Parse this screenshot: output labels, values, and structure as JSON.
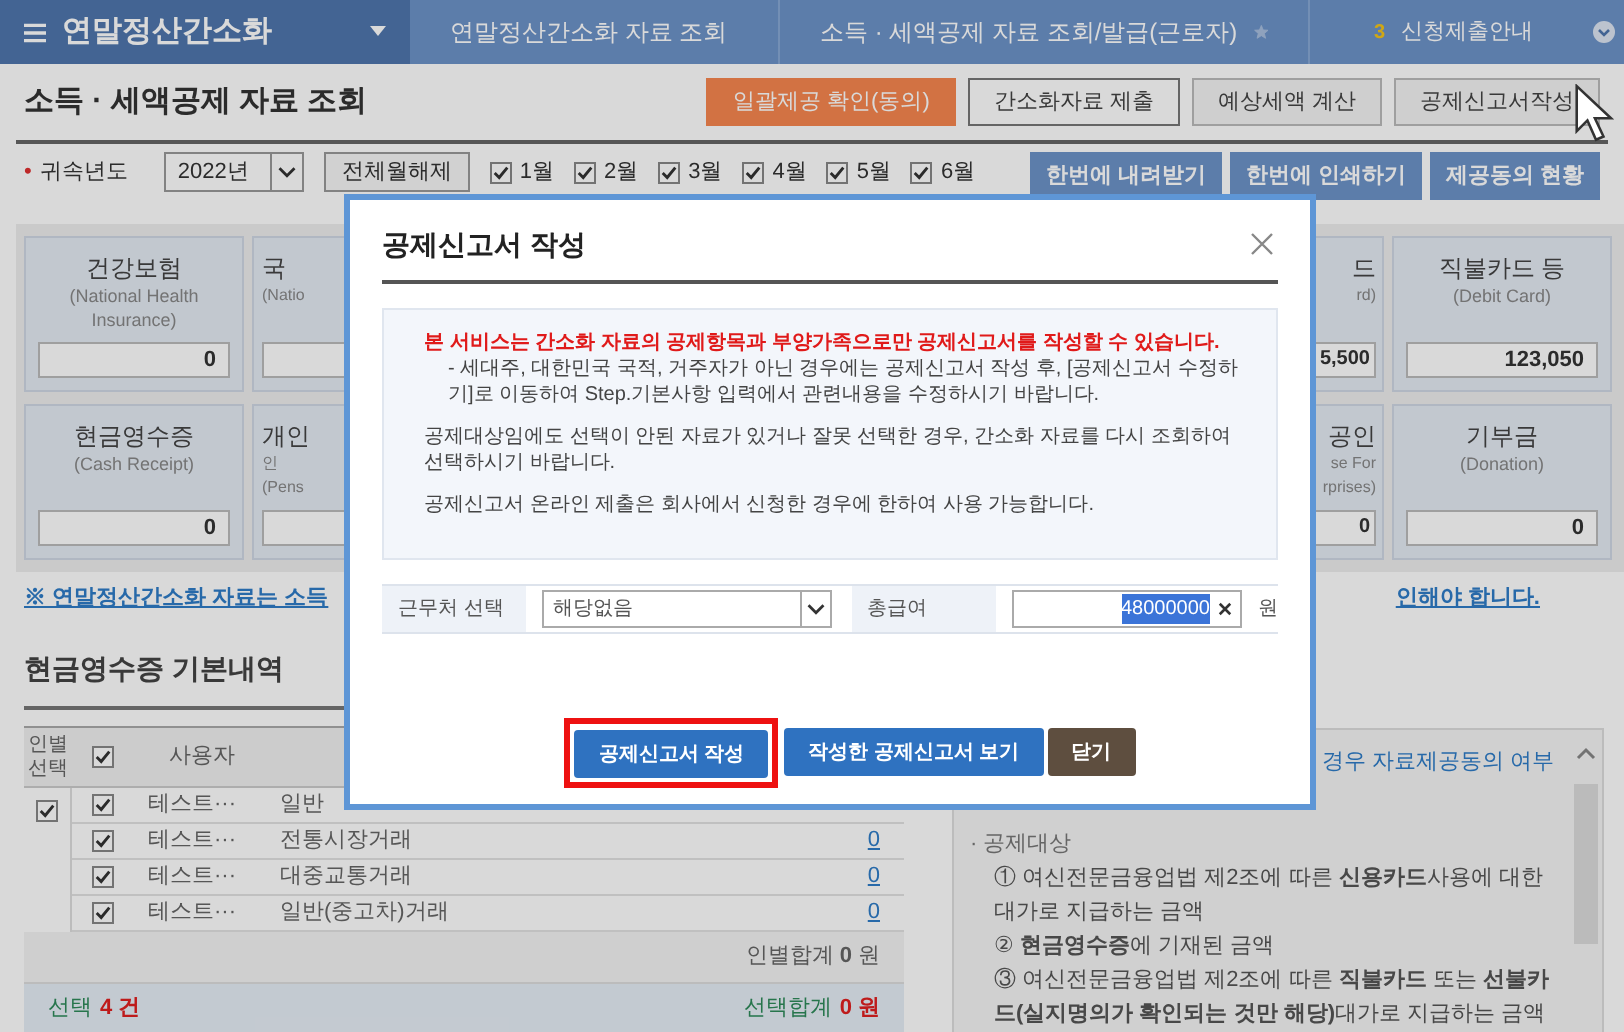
{
  "nav": {
    "menu_title": "연말정산간소화",
    "crumbs": [
      {
        "label": "연말정산간소화 자료 조회"
      },
      {
        "label": "소득 · 세액공제 자료 조회/발급(근로자)",
        "starred": false
      }
    ],
    "notice": {
      "badge": "3",
      "label": "신청제출안내"
    }
  },
  "page": {
    "title": "소득 · 세액공제 자료 조회",
    "actions": [
      {
        "label": "일괄제공 확인(동의)",
        "kind": "primary"
      },
      {
        "label": "간소화자료 제출",
        "kind": "outline"
      },
      {
        "label": "예상세액 계산",
        "kind": "plain"
      },
      {
        "label": "공제신고서작성",
        "kind": "plain"
      }
    ]
  },
  "filter": {
    "required_mark": "•",
    "year_label": "귀속년도",
    "year": "2022년",
    "toggle_all": "전체월해제",
    "months": [
      {
        "label": "1월",
        "checked": true
      },
      {
        "label": "2월",
        "checked": true
      },
      {
        "label": "3월",
        "checked": true
      },
      {
        "label": "4월",
        "checked": true
      },
      {
        "label": "5월",
        "checked": true
      },
      {
        "label": "6월",
        "checked": true
      }
    ],
    "buttons": [
      "한번에 내려받기",
      "한번에 인쇄하기",
      "제공동의 현황"
    ]
  },
  "cards": [
    [
      {
        "kind": "full",
        "label": "건강보험",
        "sub": [
          "(National Health",
          "Insurance)"
        ],
        "value": "0"
      },
      {
        "kind": "right_part",
        "label": "국",
        "sub": [
          "(Natio"
        ]
      },
      {
        "kind": "left_part",
        "label": "드",
        "sub": [
          "rd)"
        ],
        "value": "5,500"
      },
      {
        "kind": "full",
        "label": "직불카드 등",
        "sub": [
          "(Debit Card)"
        ],
        "value": "123,050"
      }
    ],
    [
      {
        "kind": "full",
        "label": "현금영수증",
        "sub": [
          "(Cash Receipt)"
        ],
        "value": "0"
      },
      {
        "kind": "right_part",
        "label": "개인",
        "sub": [
          "인",
          "(Pens"
        ]
      },
      {
        "kind": "left_part",
        "label": "공인",
        "sub": [
          "se For",
          "rprises)"
        ],
        "value": "0"
      },
      {
        "kind": "full",
        "label": "기부금",
        "sub": [
          "(Donation)"
        ],
        "value": "0"
      }
    ]
  ],
  "notice": {
    "start": "※ 연말정산간소화 자료는 소득",
    "end": "인해야 합니다."
  },
  "receipts": {
    "title": "현금영수증 기본내역",
    "columns": [
      "인별 선택",
      "사용자"
    ],
    "header_checked": true,
    "person_checked": true,
    "rows": [
      {
        "checked": true,
        "user": "테스트···",
        "type": "일반"
      },
      {
        "checked": true,
        "user": "테스트···",
        "type": "전통시장거래",
        "amount": "0"
      },
      {
        "checked": true,
        "user": "테스트···",
        "type": "대중교통거래",
        "amount": "0"
      },
      {
        "checked": true,
        "user": "테스트···",
        "type": "일반(중고차)거래",
        "amount": "0"
      }
    ],
    "person_total": "인별합계 **0** 원",
    "selected": {
      "label": "선택",
      "count": "4",
      "unit": "건"
    },
    "selected_total": {
      "label": "선택합계",
      "amount": "0",
      "unit": "원"
    }
  },
  "help": {
    "lead": "경우 자료제공동의 여부",
    "heading": "· 공제대상",
    "items": [
      "① 여신전문금융업법 제2조에 따른 **신용카드**사용에 대한 대가로 지급하는 금액",
      "② **현금영수증**에 기재된 금액",
      "③ 여신전문금융업법 제2조에 따른 **직불카드** 또는 **선불카드(실지명의가 확인되는 것만 해당)**대가로 지급하는 금액"
    ]
  },
  "dialog": {
    "title": "공제신고서 작성",
    "notes": [
      {
        "text": "본 서비스는 간소화 자료의 공제항목과 부양가족으로만 공제신고서를 작성할 수 있습니다.",
        "kind": "warning"
      },
      {
        "text": "- 세대주, 대한민국 국적, 거주자가 아닌 경우에는 공제신고서 작성 후, [공제신고서 수정하기]로 이동하여 Step.기본사항 입력에서 관련내용을 수정하시기 바랍니다.",
        "kind": "sub"
      },
      {
        "text": "공제대상임에도 선택이 안된 자료가 있거나 잘못 선택한 경우, 간소화 자료를 다시 조회하여 선택하시기 바랍니다.",
        "kind": "bullet"
      },
      {
        "text": "공제신고서 온라인 제출은 회사에서 신청한 경우에 한하여 사용 가능합니다.",
        "kind": "bullet"
      }
    ],
    "workplace_label": "근무처 선택",
    "workplace": "해당없음",
    "salary_label": "총급여",
    "salary": "48000000",
    "salary_unit": "원",
    "buttons": [
      {
        "label": "공제신고서 작성",
        "kind": "primary",
        "highlighted": true
      },
      {
        "label": "작성한 공제신고서 보기",
        "kind": "primary",
        "highlighted": false
      },
      {
        "label": "닫기",
        "kind": "dark",
        "highlighted": false
      }
    ]
  }
}
